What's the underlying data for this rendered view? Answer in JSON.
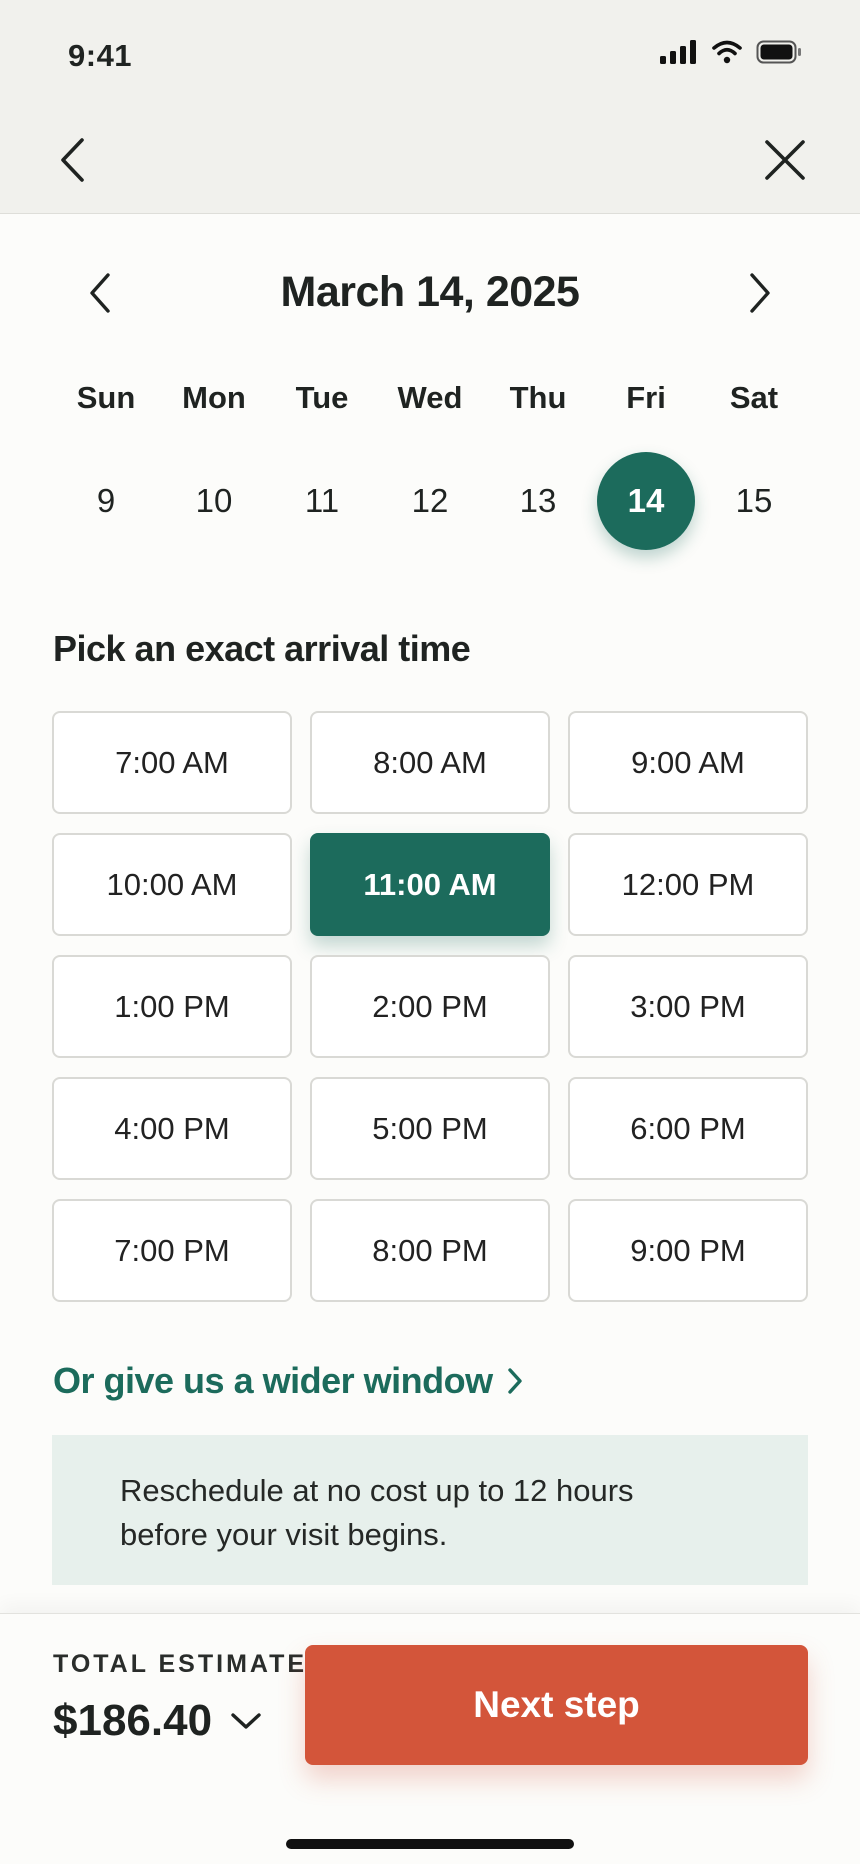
{
  "status": {
    "time": "9:41"
  },
  "calendar": {
    "month_title": "March 14, 2025",
    "weekdays": [
      "Sun",
      "Mon",
      "Tue",
      "Wed",
      "Thu",
      "Fri",
      "Sat"
    ],
    "days": [
      "9",
      "10",
      "11",
      "12",
      "13",
      "14",
      "15"
    ],
    "selected_day": "14"
  },
  "times": {
    "title": "Pick an exact arrival time",
    "slots": [
      "7:00 AM",
      "8:00 AM",
      "9:00 AM",
      "10:00 AM",
      "11:00 AM",
      "12:00 PM",
      "1:00 PM",
      "2:00 PM",
      "3:00 PM",
      "4:00 PM",
      "5:00 PM",
      "6:00 PM",
      "7:00 PM",
      "8:00 PM",
      "9:00 PM"
    ],
    "selected_slot": "11:00 AM"
  },
  "wider_window": {
    "label": "Or give us a wider window"
  },
  "notice": {
    "text": "Reschedule at no cost up to 12 hours before your visit begins."
  },
  "footer": {
    "total_label": "TOTAL ESTIMATE",
    "total_value": "$186.40",
    "next_label": "Next step"
  },
  "colors": {
    "accent": "#1c6b5c",
    "cta": "#d3553a",
    "notice_bg": "#e7f0ec"
  },
  "icons": {
    "signal": "signal-icon",
    "wifi": "wifi-icon",
    "battery": "battery-icon",
    "back": "chevron-left-icon",
    "close": "close-icon",
    "prev_month": "chevron-left-icon",
    "next_month": "chevron-right-icon",
    "wider": "chevron-right-icon",
    "expand_total": "chevron-down-icon"
  }
}
